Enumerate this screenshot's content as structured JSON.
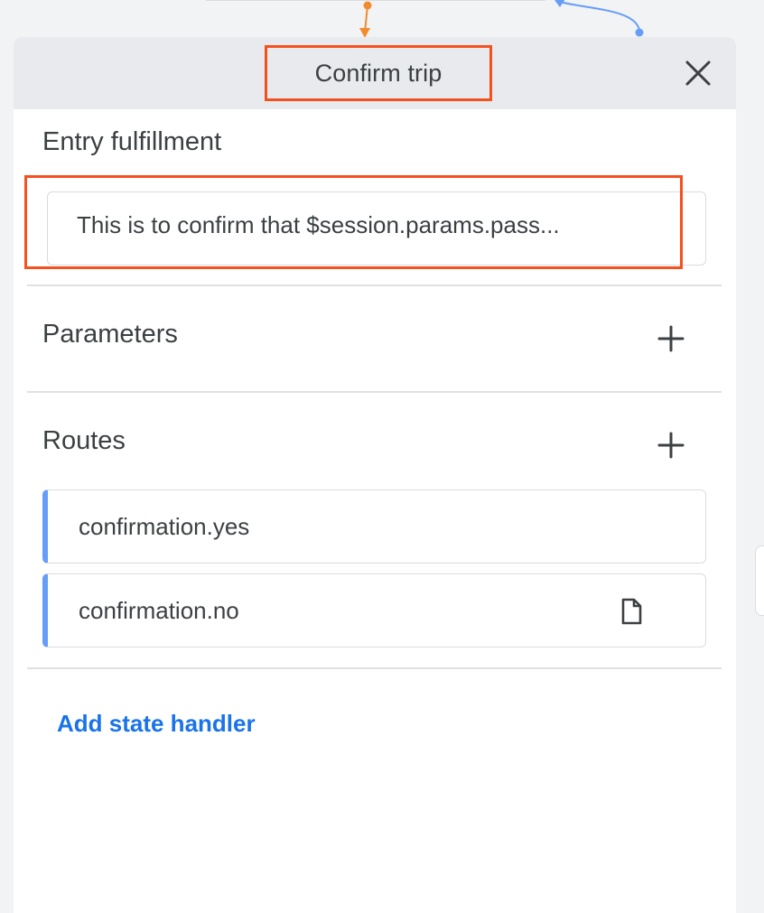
{
  "panel": {
    "title": "Confirm trip",
    "close_icon": "close-icon"
  },
  "entry_fulfillment": {
    "heading": "Entry fulfillment",
    "text": "This is to confirm that $session.params.pass..."
  },
  "parameters": {
    "heading": "Parameters",
    "add_icon": "plus-icon"
  },
  "routes": {
    "heading": "Routes",
    "add_icon": "plus-icon",
    "items": [
      {
        "label": "confirmation.yes"
      },
      {
        "label": "confirmation.no",
        "icon": "document-icon"
      }
    ]
  },
  "add_state_handler": "Add state handler",
  "colors": {
    "highlight": "#f4511e",
    "route_accent": "#669df6",
    "link": "#1a73e8",
    "header_bg": "#e8eaed"
  }
}
